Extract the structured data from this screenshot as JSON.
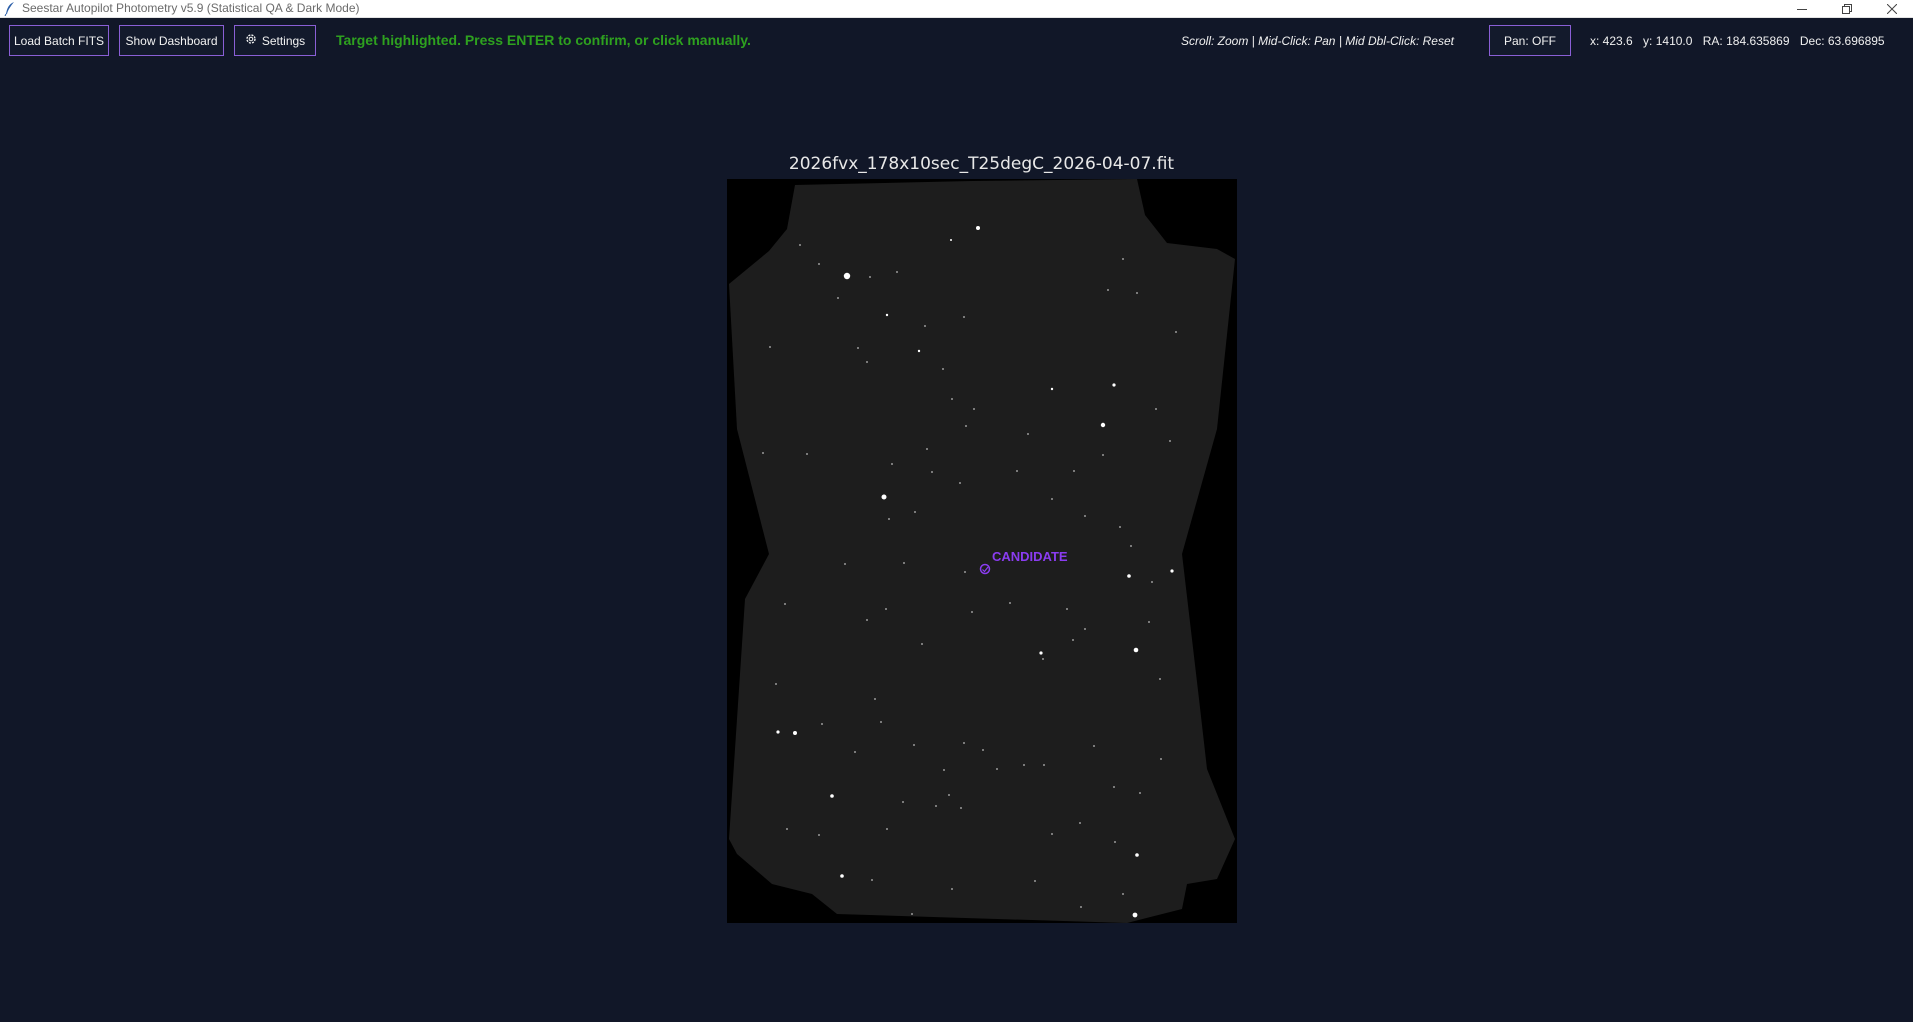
{
  "window": {
    "title": "Seestar Autopilot Photometry v5.9 (Statistical QA & Dark Mode)",
    "controls": [
      "minimize-icon",
      "restore-icon",
      "close-icon"
    ]
  },
  "toolbar": {
    "load_batch_label": "Load Batch FITS",
    "show_dashboard_label": "Show Dashboard",
    "settings_label": "Settings",
    "settings_icon": "gear-icon",
    "status_message": "Target highlighted. Press ENTER to confirm, or click manually.",
    "help_text": "Scroll: Zoom | Mid-Click: Pan | Mid Dbl-Click: Reset",
    "pan_label": "Pan: OFF"
  },
  "coordinates": {
    "x": "x: 423.6",
    "y": "y: 1410.0",
    "ra": "RA: 184.635869",
    "dec": "Dec: 63.696895"
  },
  "viewer": {
    "filename": "2026fvx_178x10sec_T25degC_2026-04-07.fit",
    "candidate_label": "CANDIDATE"
  },
  "colors": {
    "background": "#111728",
    "accent": "#8a5fd6",
    "status_green": "#2ea11f",
    "candidate_purple": "#8a3cf0"
  }
}
